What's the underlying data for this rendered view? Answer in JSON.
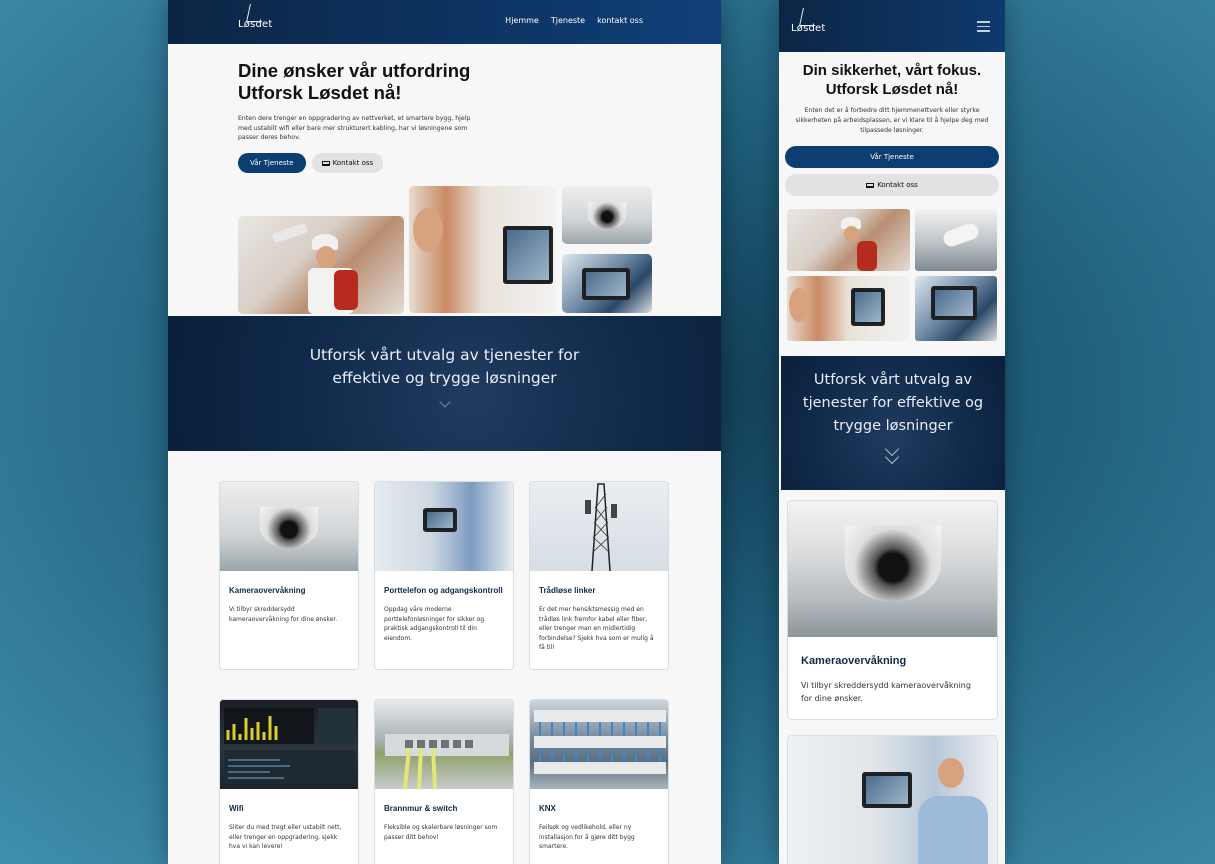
{
  "brand": {
    "logo_text": "Løsdet"
  },
  "desktop": {
    "nav": {
      "items": [
        "Hjemme",
        "Tjeneste",
        "kontakt oss"
      ]
    },
    "hero": {
      "title_line1": "Dine ønsker vår utfordring",
      "title_line2": "Utforsk Løsdet nå!",
      "lead": "Enten dere trenger en oppgradering av nettverket, et smartere bygg, hjelp med ustabilt wifi eller bare mer strukturert kabling, har vi løsningene som passer deres behov.",
      "primary_button": "Vår Tjeneste",
      "secondary_button": "Kontakt oss"
    },
    "band": {
      "line1": "Utforsk vårt utvalg av tjenester for",
      "line2": "effektive og trygge løsninger"
    },
    "cards": [
      {
        "title": "Kameraovervåkning",
        "text": "Vi tilbyr skreddersydd kameraovervåkning for dine ønsker."
      },
      {
        "title": "Porttelefon og adgangskontroll",
        "text": "Oppdag våre moderne porttelefonløsninger for sikker og praktisk adgangskontroll til din eiendom."
      },
      {
        "title": "Trådløse linker",
        "text": "Er det mer hensiktsmessig med en trådløs link fremfor kabel eller fiber, eller trenger man en midlertidig forbindelse? Sjekk hva som er mulig å få til!"
      },
      {
        "title": "Wifi",
        "text": "Sliter du med tregt eller ustabilt nett, eller trenger en oppgradering, sjekk hva vi kan levere!"
      },
      {
        "title": "Brannmur & switch",
        "text": "Fleksible og skalerbare løsninger som passer ditt behov!"
      },
      {
        "title": "KNX",
        "text": "Feilsøk og vedlikehold, eller ny installasjon for å gjøre ditt bygg smartere."
      }
    ]
  },
  "mobile": {
    "hero": {
      "title_line1": "Din sikkerhet, vårt fokus.",
      "title_line2": "Utforsk Løsdet nå!",
      "lead": "Enten det er å forbedre ditt hjemmenettverk eller styrke sikkerheten på arbeidsplassen, er vi klare til å hjelpe deg med tilpassede løsninger.",
      "primary_button": "Vår Tjeneste",
      "secondary_button": "Kontakt oss"
    },
    "band": {
      "line1": "Utforsk vårt utvalg av",
      "line2": "tjenester for effektive og",
      "line3": "trygge løsninger"
    },
    "cards": [
      {
        "title": "Kameraovervåkning",
        "text": "Vi tilbyr skreddersydd kameraovervåkning for dine ønsker."
      }
    ]
  }
}
